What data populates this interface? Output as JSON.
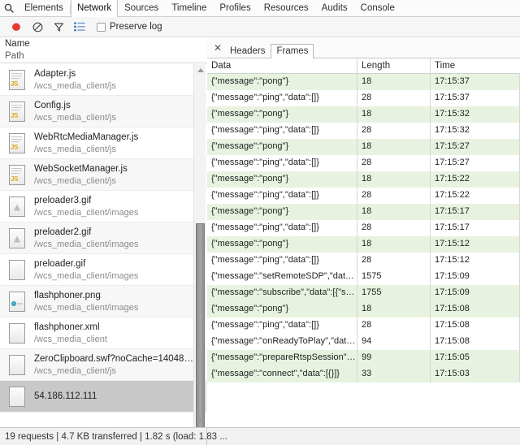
{
  "window": {
    "tabs": [
      {
        "label": "Elements",
        "active": false
      },
      {
        "label": "Network",
        "active": true
      },
      {
        "label": "Sources",
        "active": false
      },
      {
        "label": "Timeline",
        "active": false
      },
      {
        "label": "Profiles",
        "active": false
      },
      {
        "label": "Resources",
        "active": false
      },
      {
        "label": "Audits",
        "active": false
      },
      {
        "label": "Console",
        "active": false
      }
    ],
    "search_icon": "search-icon"
  },
  "toolbar": {
    "record_icon": "record-icon",
    "clear_icon": "clear-icon",
    "filter_icon": "filter-icon",
    "view_list_icon": "view-list-icon",
    "preserve_log_label": "Preserve log",
    "preserve_log_checked": false
  },
  "left_panel": {
    "header": {
      "name_label": "Name",
      "path_label": "Path"
    },
    "files": [
      {
        "name": "Adapter.js",
        "path": "/wcs_media_client/js",
        "type": "js",
        "selected": false
      },
      {
        "name": "Config.js",
        "path": "/wcs_media_client/js",
        "type": "js",
        "selected": false
      },
      {
        "name": "WebRtcMediaManager.js",
        "path": "/wcs_media_client/js",
        "type": "js",
        "selected": false
      },
      {
        "name": "WebSocketManager.js",
        "path": "/wcs_media_client/js",
        "type": "js",
        "selected": false
      },
      {
        "name": "preloader3.gif",
        "path": "/wcs_media_client/images",
        "type": "image",
        "selected": false
      },
      {
        "name": "preloader2.gif",
        "path": "/wcs_media_client/images",
        "type": "image",
        "selected": false
      },
      {
        "name": "preloader.gif",
        "path": "/wcs_media_client/images",
        "type": "blank",
        "selected": false
      },
      {
        "name": "flashphoner.png",
        "path": "/wcs_media_client/images",
        "type": "png",
        "selected": false
      },
      {
        "name": "flashphoner.xml",
        "path": "/wcs_media_client",
        "type": "blank",
        "selected": false
      },
      {
        "name": "ZeroClipboard.swf?noCache=14048145...",
        "path": "/wcs_media_client/js",
        "type": "blank",
        "selected": false
      },
      {
        "name": "54.186.112.111",
        "path": "",
        "type": "blank",
        "selected": true
      }
    ],
    "scrollbar": {
      "up_icon": "chevron-up-icon",
      "down_icon": "chevron-down-icon"
    }
  },
  "right_panel": {
    "close_icon": "close-icon",
    "tabs": [
      {
        "label": "Headers",
        "active": false
      },
      {
        "label": "Frames",
        "active": true
      }
    ],
    "columns": [
      "Data",
      "Length",
      "Time"
    ],
    "rows": [
      {
        "data": "{\"message\":\"pong\"}",
        "length": "18",
        "time": "17:15:37",
        "green": true
      },
      {
        "data": "{\"message\":\"ping\",\"data\":[]}",
        "length": "28",
        "time": "17:15:37",
        "green": false
      },
      {
        "data": "{\"message\":\"pong\"}",
        "length": "18",
        "time": "17:15:32",
        "green": true
      },
      {
        "data": "{\"message\":\"ping\",\"data\":[]}",
        "length": "28",
        "time": "17:15:32",
        "green": false
      },
      {
        "data": "{\"message\":\"pong\"}",
        "length": "18",
        "time": "17:15:27",
        "green": true
      },
      {
        "data": "{\"message\":\"ping\",\"data\":[]}",
        "length": "28",
        "time": "17:15:27",
        "green": false
      },
      {
        "data": "{\"message\":\"pong\"}",
        "length": "18",
        "time": "17:15:22",
        "green": true
      },
      {
        "data": "{\"message\":\"ping\",\"data\":[]}",
        "length": "28",
        "time": "17:15:22",
        "green": false
      },
      {
        "data": "{\"message\":\"pong\"}",
        "length": "18",
        "time": "17:15:17",
        "green": true
      },
      {
        "data": "{\"message\":\"ping\",\"data\":[]}",
        "length": "28",
        "time": "17:15:17",
        "green": false
      },
      {
        "data": "{\"message\":\"pong\"}",
        "length": "18",
        "time": "17:15:12",
        "green": true
      },
      {
        "data": "{\"message\":\"ping\",\"data\":[]}",
        "length": "28",
        "time": "17:15:12",
        "green": false
      },
      {
        "data": "{\"message\":\"setRemoteSDP\",\"data\"...",
        "length": "1575",
        "time": "17:15:09",
        "green": false
      },
      {
        "data": "{\"message\":\"subscribe\",\"data\":[{\"sd...",
        "length": "1755",
        "time": "17:15:09",
        "green": true
      },
      {
        "data": "{\"message\":\"pong\"}",
        "length": "18",
        "time": "17:15:08",
        "green": true
      },
      {
        "data": "{\"message\":\"ping\",\"data\":[]}",
        "length": "28",
        "time": "17:15:08",
        "green": false
      },
      {
        "data": "{\"message\":\"onReadyToPlay\",\"data...",
        "length": "94",
        "time": "17:15:08",
        "green": false
      },
      {
        "data": "{\"message\":\"prepareRtspSession\",\"...",
        "length": "99",
        "time": "17:15:05",
        "green": true
      },
      {
        "data": "{\"message\":\"connect\",\"data\":[{}]}",
        "length": "33",
        "time": "17:15:03",
        "green": true
      }
    ]
  },
  "status_bar": {
    "text": "19 requests | 4.7 KB transferred | 1.82 s (load: 1.83 ..."
  },
  "colors": {
    "row_green": "#e7f3e0",
    "record_red": "#e23b2e",
    "selection_gray": "#c8c8c8"
  }
}
